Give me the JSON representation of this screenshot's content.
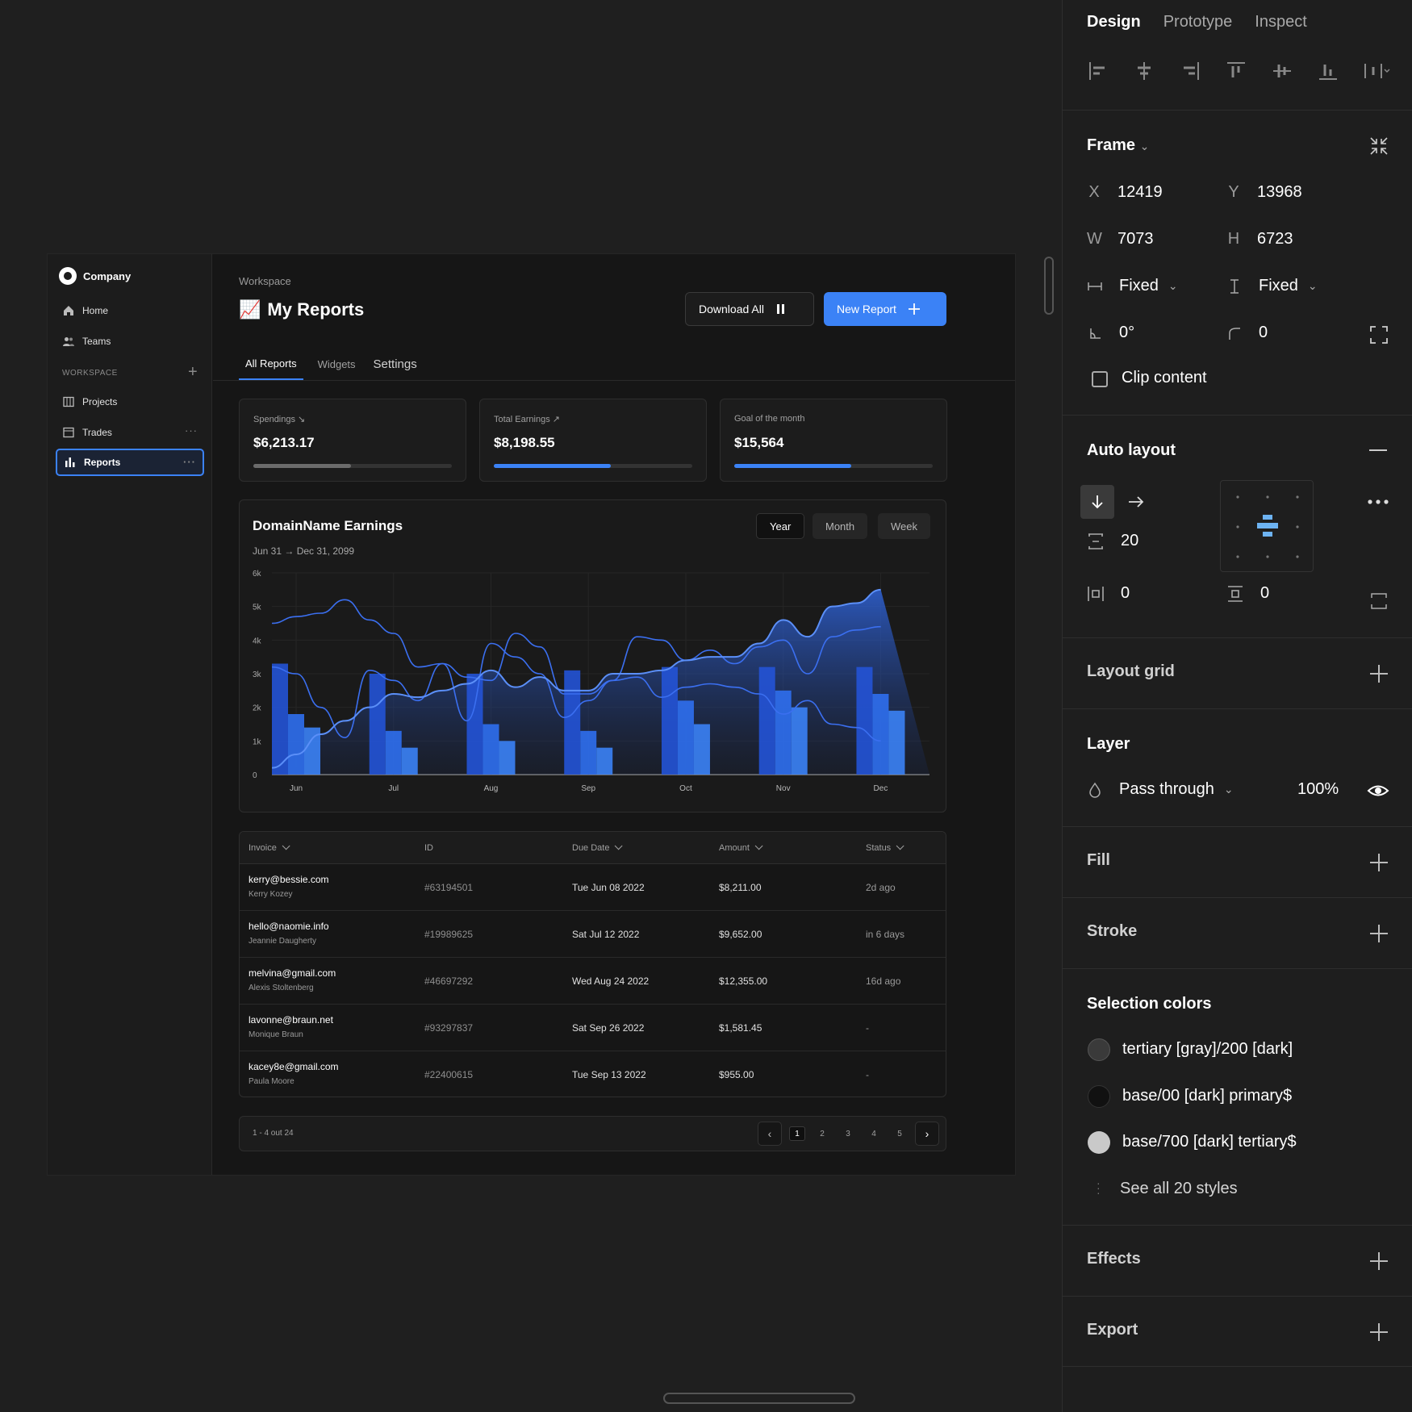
{
  "app": {
    "brand": "Company",
    "nav": [
      {
        "label": "Home"
      },
      {
        "label": "Teams"
      }
    ],
    "workspace_label": "WORKSPACE",
    "workspace_items": [
      {
        "label": "Projects"
      },
      {
        "label": "Trades"
      },
      {
        "label": "Reports"
      }
    ],
    "breadcrumb": "Workspace",
    "title_emoji": "📈",
    "title": "My Reports",
    "download_label": "Download All",
    "new_report_label": "New Report",
    "tabs": [
      "All Reports",
      "Widgets",
      "Settings"
    ],
    "cards": [
      {
        "label": "Spendings ↘",
        "value": "$6,213.17",
        "progress": 0.49,
        "color": "#6b6b6b"
      },
      {
        "label": "Total Earnings ↗",
        "value": "$8,198.55",
        "progress": 0.59,
        "color": "#3b82f6"
      },
      {
        "label": "Goal of the month",
        "value": "$15,564",
        "progress": 0.59,
        "color": "#3b82f6"
      }
    ]
  },
  "chart_data": {
    "type": "bar",
    "title": "DomainName Earnings",
    "subtitle": "Jun 31 → Dec 31, 2099",
    "ranges": [
      "Year",
      "Month",
      "Week"
    ],
    "selected_range": "Year",
    "y_ticks": [
      "6k",
      "5k",
      "4k",
      "3k",
      "2k",
      "1k",
      "0"
    ],
    "ylim": [
      0,
      6000
    ],
    "categories": [
      "Jun",
      "Jul",
      "Aug",
      "Sep",
      "Oct",
      "Nov",
      "Dec"
    ],
    "series": [
      {
        "values": [
          3300,
          3000,
          3000,
          3100,
          3200,
          3200,
          3200
        ]
      },
      {
        "values": [
          1800,
          1300,
          1500,
          1300,
          2200,
          2500,
          2400
        ]
      },
      {
        "values": [
          1400,
          800,
          1000,
          800,
          1500,
          2000,
          1900
        ]
      }
    ],
    "line_series": [
      {
        "x": [
          0,
          0.25,
          0.5,
          0.75,
          1,
          1.25,
          1.5,
          1.75,
          2,
          2.25,
          2.5,
          2.75,
          3,
          3.25,
          3.5,
          3.75,
          4,
          4.25,
          4.5,
          4.75,
          5,
          5.25,
          5.5,
          5.75,
          6,
          6.25
        ],
        "y": [
          3200,
          3000,
          2000,
          1100,
          3100,
          2800,
          2200,
          3300,
          1600,
          3900,
          3500,
          3000,
          1700,
          2200,
          2800,
          4100,
          4000,
          3400,
          3700,
          3300,
          3800,
          4000,
          3000,
          4100,
          4300,
          4400
        ]
      },
      {
        "x": [
          0,
          0.25,
          0.5,
          0.75,
          1,
          1.25,
          1.5,
          1.75,
          2,
          2.25,
          2.5,
          2.75,
          3,
          3.25,
          3.5,
          3.75,
          4,
          4.25,
          4.5,
          4.75,
          5,
          5.25,
          5.5,
          5.75,
          6,
          6.25
        ],
        "y": [
          4500,
          4700,
          4800,
          5200,
          4600,
          4200,
          3200,
          3300,
          2900,
          2800,
          4200,
          3800,
          2400,
          2400,
          2800,
          2900,
          2300,
          2600,
          2700,
          2600,
          2400,
          1800,
          2200,
          1500,
          1400,
          1000
        ]
      },
      {
        "x": [
          0,
          0.25,
          0.5,
          0.75,
          1,
          1.25,
          1.5,
          1.75,
          2,
          2.25,
          2.5,
          2.75,
          3,
          3.25,
          3.5,
          3.75,
          4,
          4.25,
          4.5,
          4.75,
          5,
          5.25,
          5.5,
          5.75,
          6,
          6.25
        ],
        "y": [
          200,
          600,
          1200,
          1600,
          2000,
          2400,
          2300,
          2500,
          2700,
          3100,
          2600,
          2900,
          2500,
          2500,
          3000,
          3000,
          3100,
          3400,
          3500,
          3500,
          3900,
          4600,
          4100,
          5000,
          5100,
          5500
        ]
      }
    ],
    "accent_color": "#3b82f6"
  },
  "table": {
    "headers": [
      "Invoice",
      "ID",
      "Due Date",
      "Amount",
      "Status"
    ],
    "rows": [
      {
        "email": "kerry@bessie.com",
        "name": "Kerry Kozey",
        "id": "#63194501",
        "date": "Tue Jun 08 2022",
        "amount": "$8,211.00",
        "status": "2d ago"
      },
      {
        "email": "hello@naomie.info",
        "name": "Jeannie Daugherty",
        "id": "#19989625",
        "date": "Sat Jul 12 2022",
        "amount": "$9,652.00",
        "status": "in 6 days"
      },
      {
        "email": "melvina@gmail.com",
        "name": "Alexis Stoltenberg",
        "id": "#46697292",
        "date": "Wed Aug 24 2022",
        "amount": "$12,355.00",
        "status": "16d ago"
      },
      {
        "email": "lavonne@braun.net",
        "name": "Monique Braun",
        "id": "#93297837",
        "date": "Sat Sep 26 2022",
        "amount": "$1,581.45",
        "status": "-"
      },
      {
        "email": "kacey8e@gmail.com",
        "name": "Paula Moore",
        "id": "#22400615",
        "date": "Tue Sep 13 2022",
        "amount": "$955.00",
        "status": "-"
      }
    ]
  },
  "pagination": {
    "info": "1 - 4 out 24",
    "pages": [
      "1",
      "2",
      "3",
      "4",
      "5"
    ],
    "current": "1"
  },
  "inspector": {
    "tabs": [
      "Design",
      "Prototype",
      "Inspect"
    ],
    "frame_title": "Frame",
    "x_label": "X",
    "x": "12419",
    "y_label": "Y",
    "y": "13968",
    "w_label": "W",
    "w": "7073",
    "h_label": "H",
    "h": "6723",
    "h_sizing": "Fixed",
    "v_sizing": "Fixed",
    "rotation": "0°",
    "radius": "0",
    "clip_content": "Clip content",
    "auto_layout_title": "Auto layout",
    "gap": "20",
    "padding_h": "0",
    "padding_v": "0",
    "layout_grid_title": "Layout grid",
    "layer_title": "Layer",
    "blend_mode": "Pass through",
    "opacity": "100%",
    "fill_title": "Fill",
    "stroke_title": "Stroke",
    "selection_colors_title": "Selection colors",
    "selection_colors": [
      {
        "name": "tertiary [gray]/200 [dark]",
        "color": "#3a3a3a"
      },
      {
        "name": "base/00 [dark] primary$",
        "color": "#111111"
      },
      {
        "name": "base/700 [dark] tertiary$",
        "color": "#c9c9c9"
      }
    ],
    "see_all": "See all 20 styles",
    "effects_title": "Effects",
    "export_title": "Export"
  }
}
